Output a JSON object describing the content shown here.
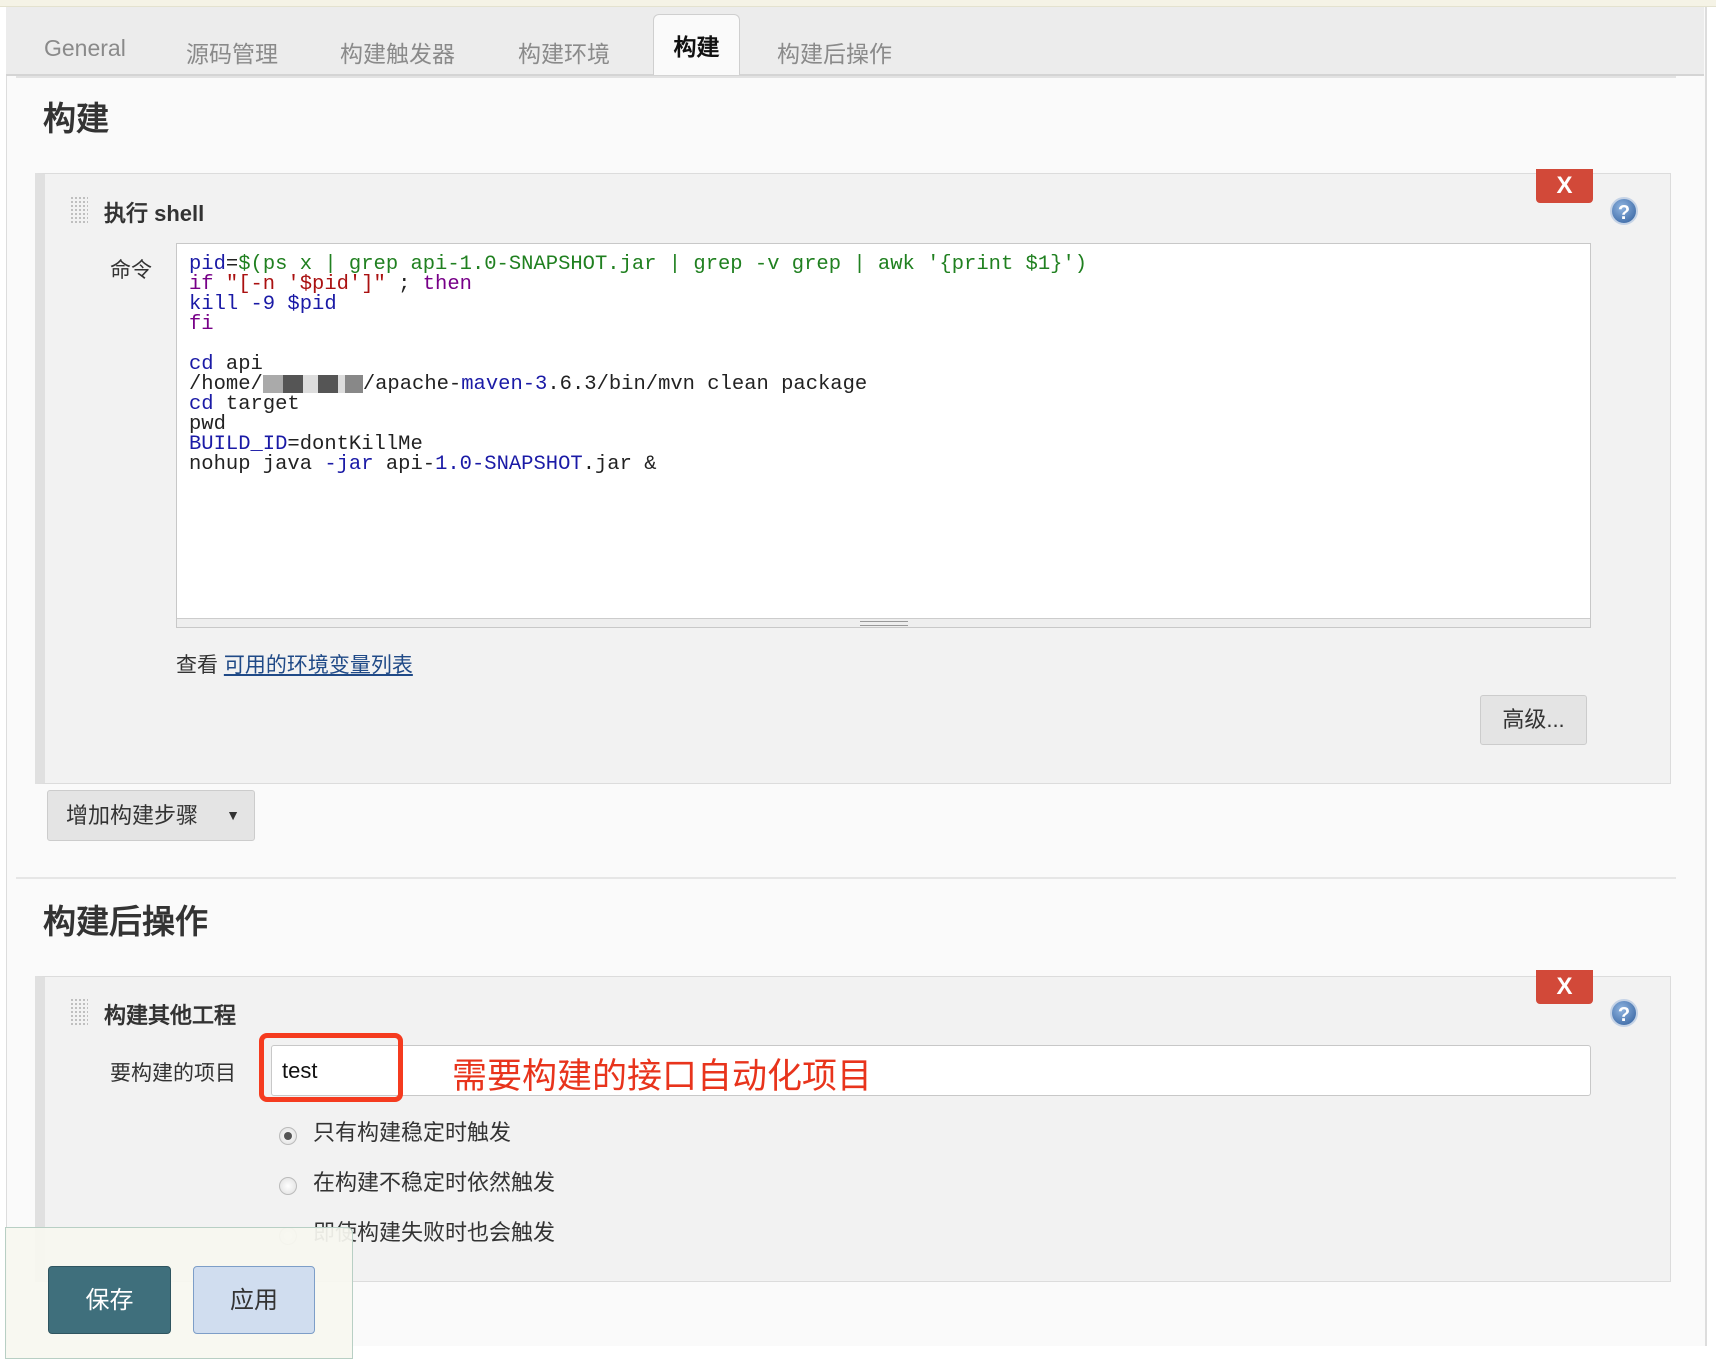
{
  "tabs": [
    {
      "label": "General",
      "active": false
    },
    {
      "label": "源码管理",
      "active": false
    },
    {
      "label": "构建触发器",
      "active": false
    },
    {
      "label": "构建环境",
      "active": false
    },
    {
      "label": "构建",
      "active": true
    },
    {
      "label": "构建后操作",
      "active": false
    }
  ],
  "build": {
    "heading": "构建",
    "step": {
      "title": "执行 shell",
      "delete_label": "X",
      "help_label": "?",
      "command_label": "命令",
      "code_lines": [
        [
          [
            "pid",
            "var"
          ],
          [
            "=",
            "plain"
          ],
          [
            "$(ps x | grep api-1.0-SNAPSHOT.jar | grep -v grep | awk '{print $1}')",
            "str"
          ]
        ],
        [
          [
            "if ",
            "kw"
          ],
          [
            "\"[-n '$pid']\"",
            "err"
          ],
          [
            " ; ",
            "plain"
          ],
          [
            "then",
            "kw"
          ]
        ],
        [
          [
            "kill -9 $pid",
            "var"
          ]
        ],
        [
          [
            "fi",
            "kw"
          ]
        ],
        [],
        [
          [
            "cd",
            "var"
          ],
          [
            " api",
            "plain"
          ]
        ],
        [
          [
            "/home/",
            "plain"
          ],
          [
            "__REDACT__",
            "redact"
          ],
          [
            "/apache-",
            "plain"
          ],
          [
            "maven-3",
            "var"
          ],
          [
            ".6.3/bin/mvn clean package",
            "plain"
          ]
        ],
        [
          [
            "cd",
            "var"
          ],
          [
            " target",
            "plain"
          ]
        ],
        [
          [
            "pwd",
            "plain"
          ]
        ],
        [
          [
            "BUILD_ID",
            "var"
          ],
          [
            "=dontKillMe",
            "plain"
          ]
        ],
        [
          [
            "nohup java ",
            "plain"
          ],
          [
            "-jar",
            "var"
          ],
          [
            " api-",
            "plain"
          ],
          [
            "1.0-SNAPSHOT",
            "var"
          ],
          [
            ".jar &",
            "plain"
          ]
        ]
      ],
      "env_prefix": "查看 ",
      "env_link": "可用的环境变量列表",
      "advanced_label": "高级..."
    },
    "add_step_label": "增加构建步骤"
  },
  "post_build": {
    "heading": "构建后操作",
    "step": {
      "title": "构建其他工程",
      "delete_label": "X",
      "help_label": "?",
      "projects_label": "要构建的项目",
      "projects_value": "test",
      "annotation": "需要构建的接口自动化项目",
      "options": [
        {
          "label": "只有构建稳定时触发",
          "selected": true
        },
        {
          "label": "在构建不稳定时依然触发",
          "selected": false
        },
        {
          "label": "即使构建失败时也会触发",
          "selected": false
        }
      ]
    }
  },
  "footer": {
    "save_label": "保存",
    "apply_label": "应用"
  },
  "colors": {
    "delete": "#d24939",
    "save": "#3f6f7c",
    "annotation": "#e8341c",
    "link": "#204a87"
  }
}
